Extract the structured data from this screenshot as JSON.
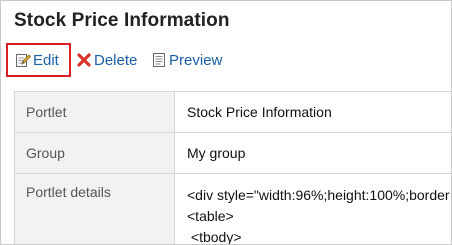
{
  "page": {
    "title": "Stock Price Information"
  },
  "toolbar": {
    "edit_label": "Edit",
    "delete_label": "Delete",
    "preview_label": "Preview"
  },
  "details": {
    "rows": [
      {
        "label": "Portlet",
        "value": "Stock Price Information"
      },
      {
        "label": "Group",
        "value": "My group"
      },
      {
        "label": "Portlet details",
        "lines": [
          "<div style=\"width:96%;height:100%;border",
          "<table>",
          " <tbody>"
        ]
      }
    ]
  },
  "colors": {
    "link": "#1a5ea8",
    "highlight_border": "#d92020",
    "label_bg": "#f2f2f2",
    "delete_icon": "#d9342b"
  },
  "icons": {
    "edit": "edit-icon",
    "delete": "delete-icon",
    "preview": "preview-icon"
  }
}
